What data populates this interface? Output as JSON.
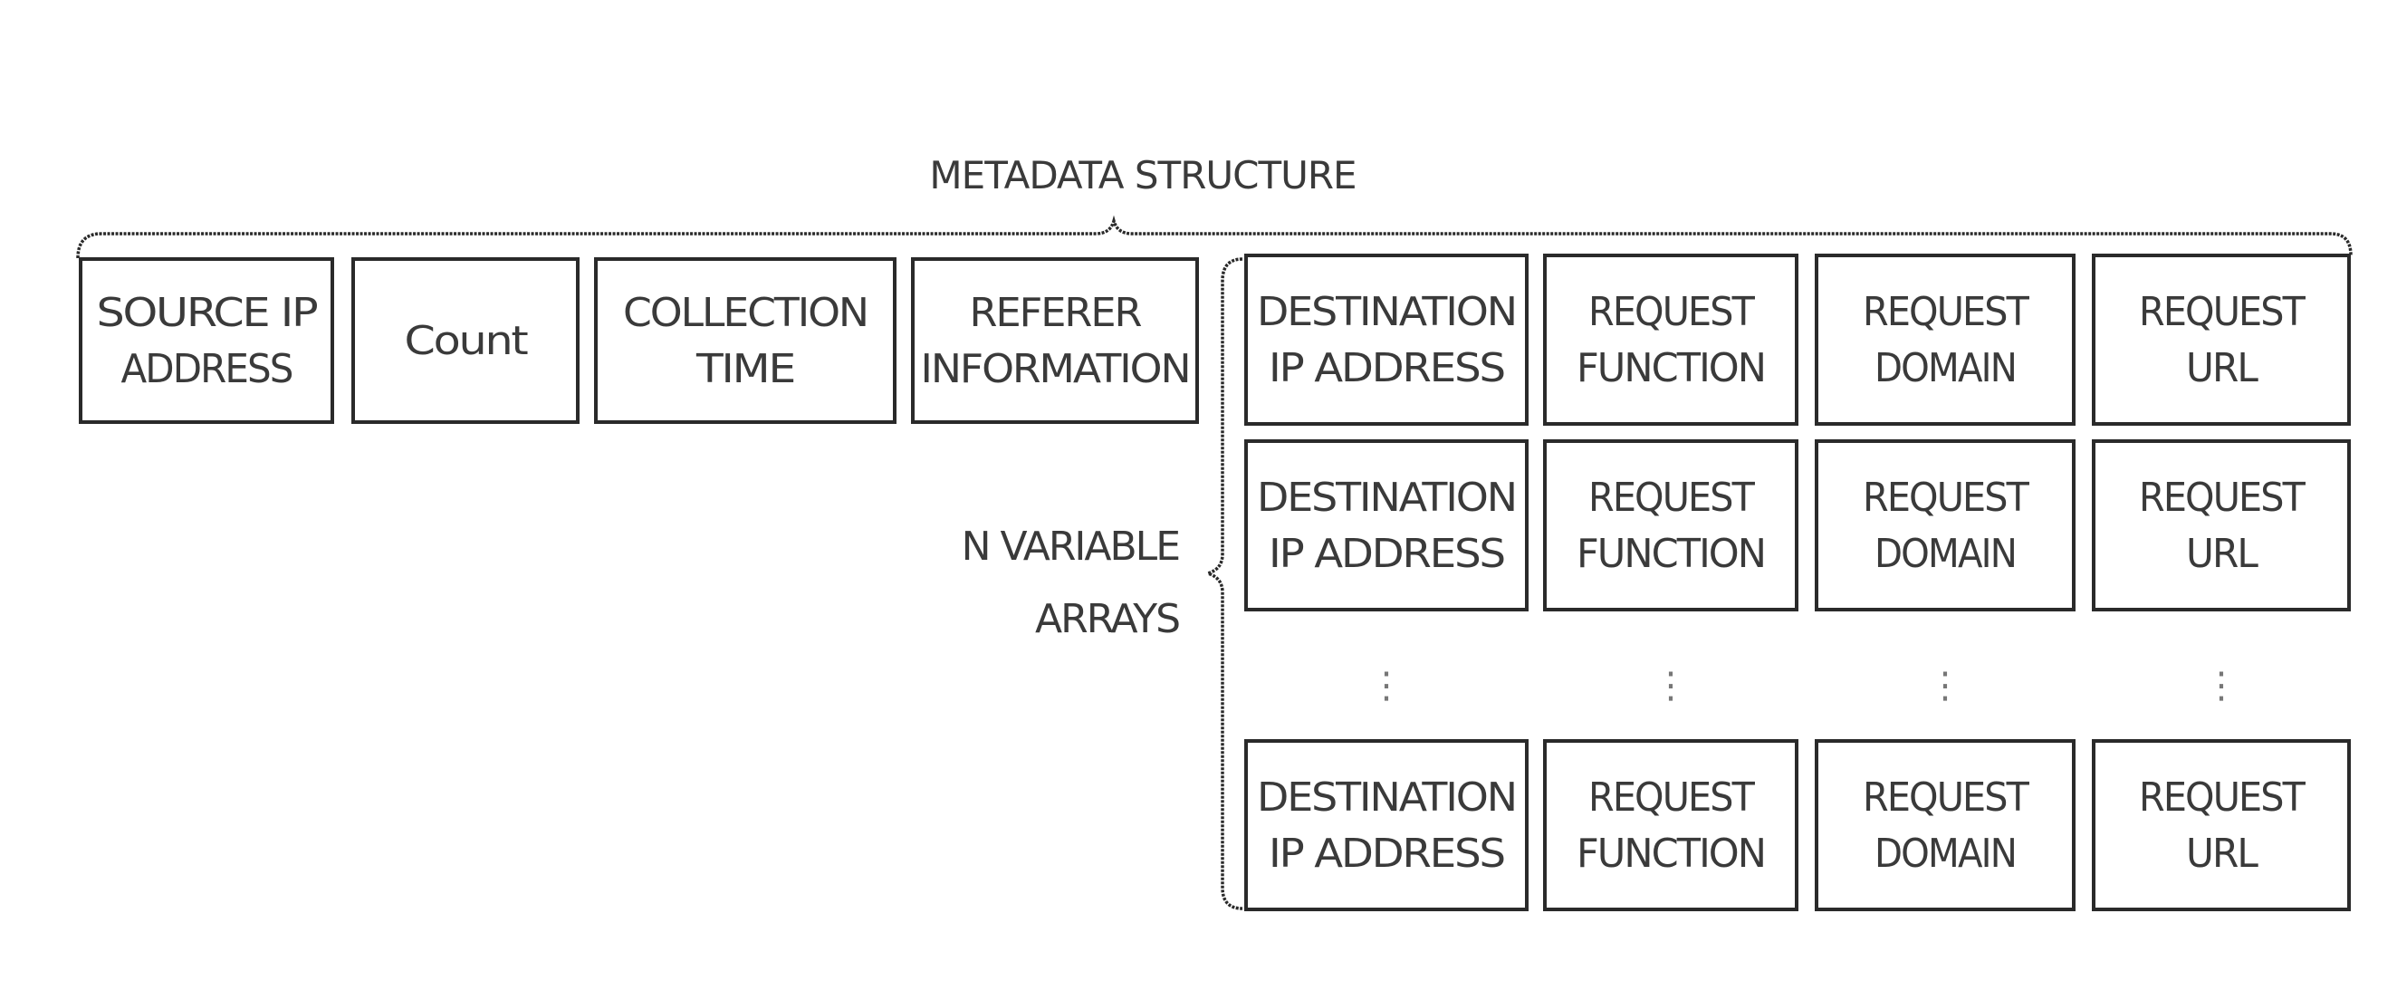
{
  "title": "METADATA STRUCTURE",
  "fixed_fields": [
    {
      "lines": [
        "SOURCE IP",
        "ADDRESS"
      ]
    },
    {
      "lines": [
        "Count"
      ]
    },
    {
      "lines": [
        "COLLECTION",
        "TIME"
      ]
    },
    {
      "lines": [
        "REFERER",
        "INFORMATION"
      ]
    }
  ],
  "array_label": {
    "lines": [
      "N VARIABLE",
      "ARRAYS"
    ]
  },
  "array_fields": [
    {
      "lines": [
        "DESTINATION",
        "IP ADDRESS"
      ]
    },
    {
      "lines": [
        "REQUEST",
        "FUNCTION"
      ]
    },
    {
      "lines": [
        "REQUEST",
        "DOMAIN"
      ]
    },
    {
      "lines": [
        "REQUEST",
        "URL"
      ]
    }
  ],
  "array_rows_shown": [
    "first",
    "second",
    "last"
  ],
  "ellipsis_symbol": "⋮",
  "colors": {
    "stroke": "#2a2a2a",
    "text": "#3a3a3a",
    "background": "#ffffff"
  }
}
